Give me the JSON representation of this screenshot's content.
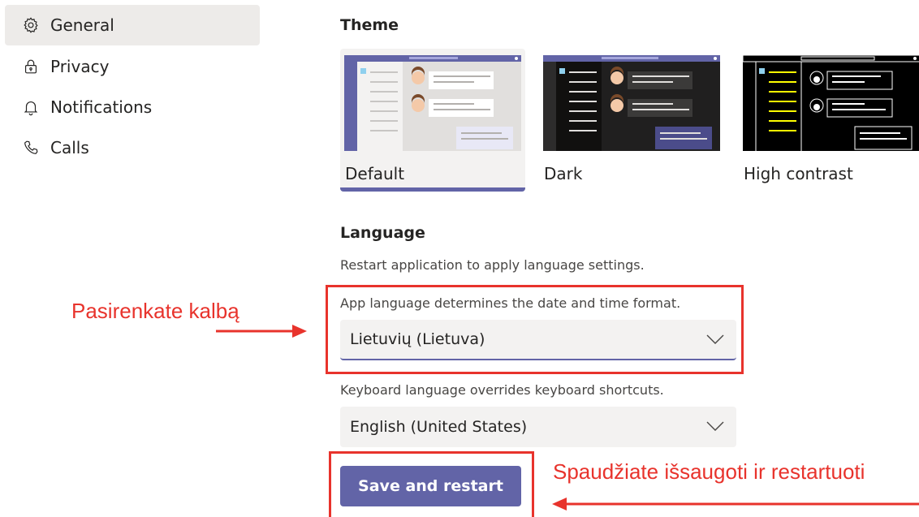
{
  "sidebar": {
    "items": [
      {
        "label": "General",
        "icon": "gear-icon",
        "active": true
      },
      {
        "label": "Privacy",
        "icon": "lock-icon",
        "active": false
      },
      {
        "label": "Notifications",
        "icon": "bell-icon",
        "active": false
      },
      {
        "label": "Calls",
        "icon": "phone-icon",
        "active": false
      }
    ]
  },
  "theme": {
    "title": "Theme",
    "options": [
      {
        "label": "Default",
        "selected": true
      },
      {
        "label": "Dark",
        "selected": false
      },
      {
        "label": "High contrast",
        "selected": false
      }
    ]
  },
  "language": {
    "title": "Language",
    "description": "Restart application to apply language settings.",
    "app_language_hint": "App language determines the date and time format.",
    "app_language_value": "Lietuvių (Lietuva)",
    "keyboard_language_hint": "Keyboard language overrides keyboard shortcuts.",
    "keyboard_language_value": "English (United States)",
    "save_label": "Save and restart"
  },
  "annotations": {
    "choose_language": "Pasirenkate kalbą",
    "save_restart": "Spaudžiate išsaugoti ir restartuoti"
  },
  "colors": {
    "accent": "#6264a7",
    "annotation_red": "#e8332c",
    "selected_nav_bg": "#edebe9"
  }
}
